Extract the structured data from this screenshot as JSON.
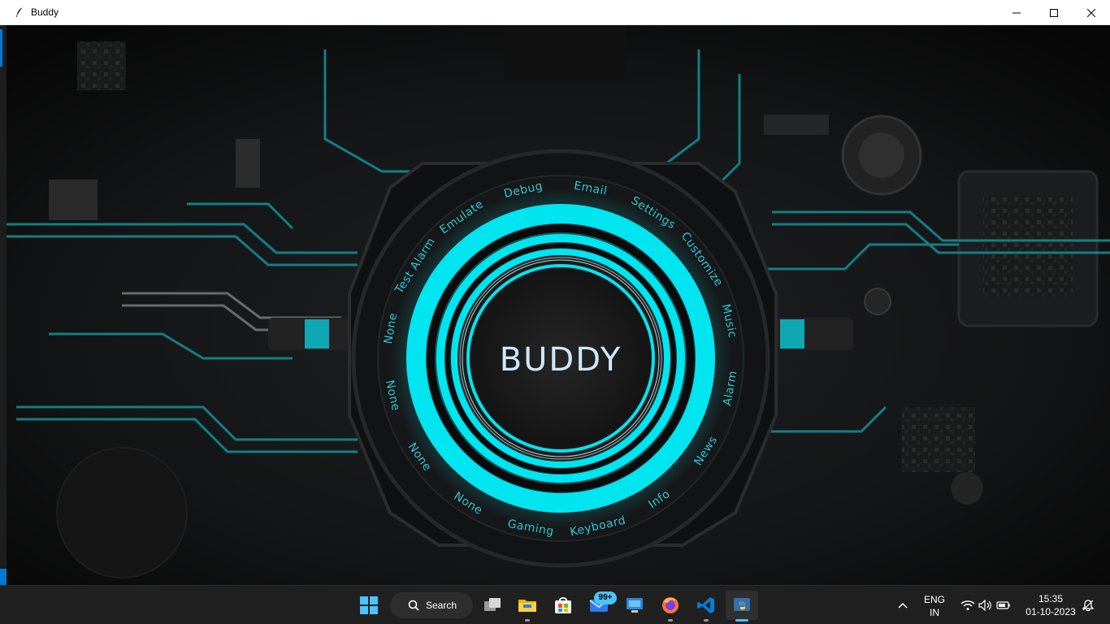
{
  "window": {
    "title": "Buddy",
    "controls": [
      "minimize",
      "maximize",
      "close"
    ]
  },
  "hud": {
    "center_text": "BUDDY",
    "ring_labels": [
      "Email",
      "Settings",
      "Customize",
      "Music",
      "Alarm",
      "News",
      "Info",
      "Keyboard",
      "Gaming",
      "None",
      "None",
      "None",
      "None",
      "Test Alarm",
      "Emulate",
      "Debug"
    ],
    "accent_color": "#00e5f0"
  },
  "taskbar": {
    "search_label": "Search",
    "mail_badge": "99+",
    "apps": [
      "start-icon",
      "search-icon",
      "task-view-icon",
      "file-explorer-icon",
      "store-icon",
      "mail-icon",
      "remote-desktop-icon",
      "firefox-icon",
      "vscode-icon",
      "python-icon"
    ],
    "language_top": "ENG",
    "language_bottom": "IN",
    "time": "15:35",
    "date": "01-10-2023"
  }
}
